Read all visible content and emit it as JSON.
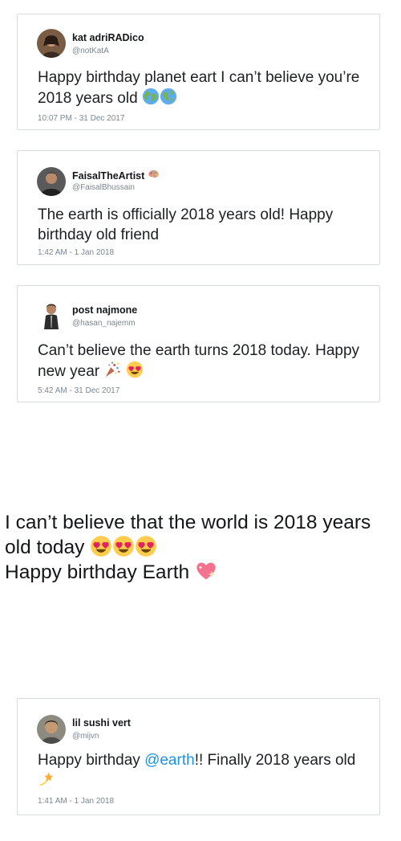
{
  "tweets": [
    {
      "name": "kat adriRADico",
      "handle": "@notKatA",
      "text": "Happy birthday planet eart I can’t believe you’re 2018 years old",
      "time": "10:07 PM - 31 Dec 2017",
      "emojis": [
        "globe-europe-africa",
        "globe-americas"
      ]
    },
    {
      "name": "FaisalTheArtist",
      "handle": "@FaisalBhussain",
      "text": "The earth is officially 2018 years old! Happy birthday old friend",
      "time": "1:42 AM - 1 Jan 2018",
      "name_emoji": "palette"
    },
    {
      "name": "post najmone",
      "handle": "@hasan_najemm",
      "text": "Can’t believe the earth turns 2018 today. Happy new year",
      "time": "5:42 AM - 31 Dec 2017",
      "emojis": [
        "confetti-ball",
        "heart-eyes-face"
      ]
    },
    {
      "name": "lil sushi vert",
      "handle": "@mijvn",
      "text_before": "Happy birthday ",
      "mention": "@earth",
      "text_after": "!! Finally 2018 years old",
      "time": "1:41 AM - 1 Jan 2018",
      "emojis": [
        "dizzy"
      ]
    }
  ],
  "caption": {
    "line1": "I can’t believe that the world is 2018 years old today",
    "line2": "Happy birthday Earth",
    "emojis_line1": [
      "heart-eyes-face",
      "heart-eyes-face",
      "heart-eyes-face"
    ],
    "emojis_line2": [
      "sparkling-heart"
    ]
  }
}
